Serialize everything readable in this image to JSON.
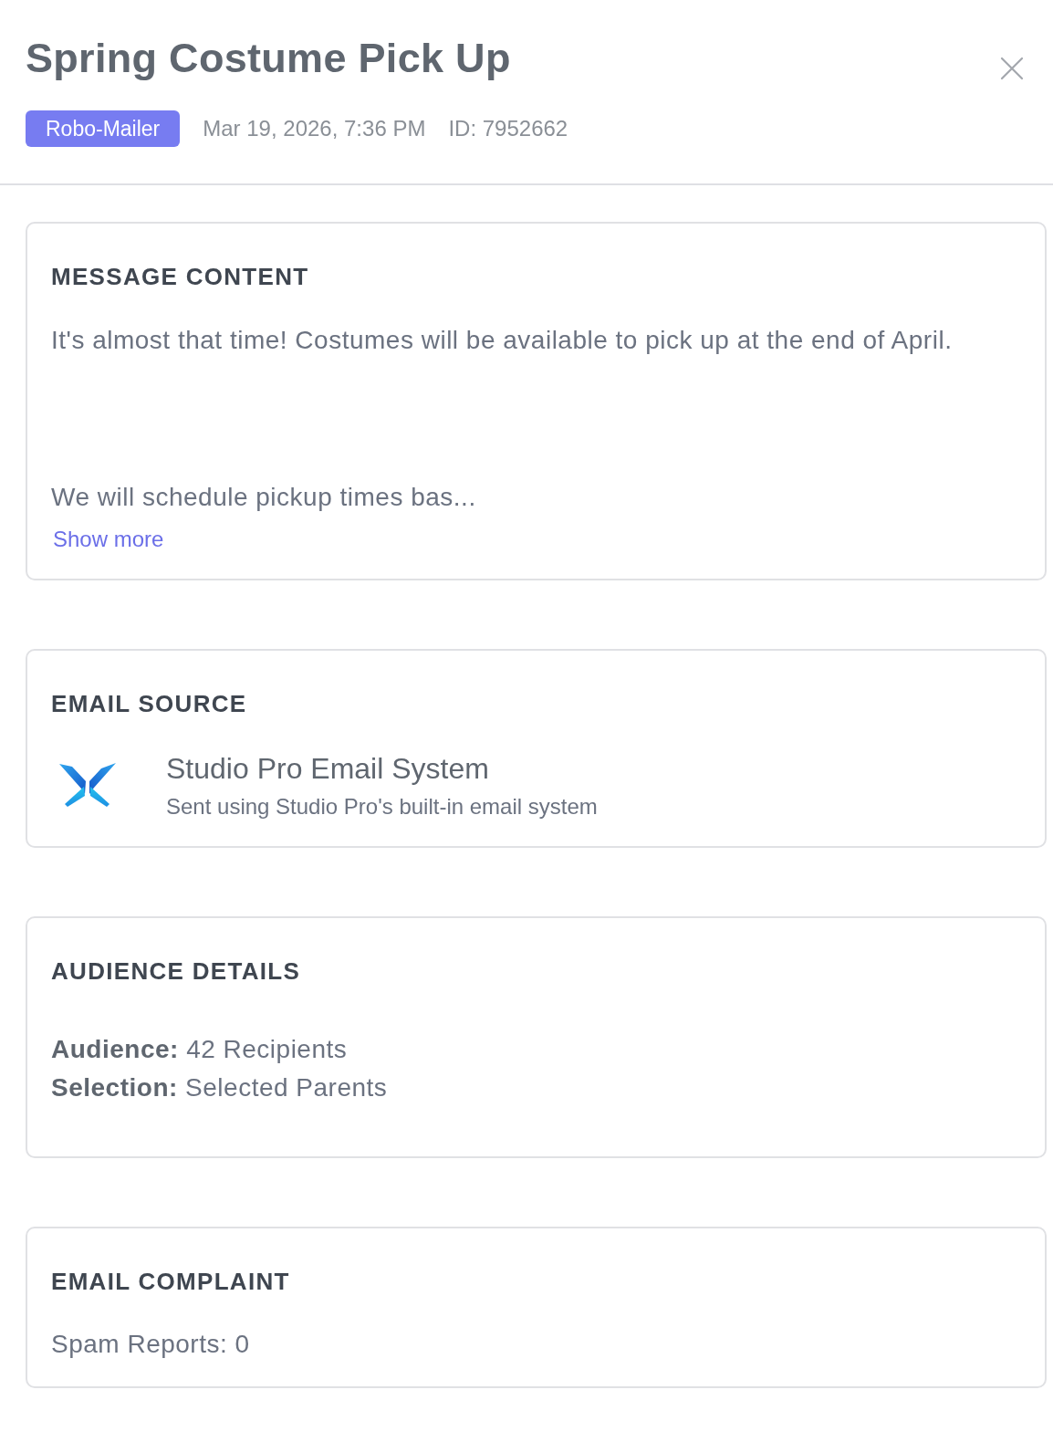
{
  "header": {
    "title": "Spring Costume Pick Up",
    "badge": "Robo-Mailer",
    "timestamp": "Mar 19, 2026, 7:36 PM",
    "id": "ID: 7952662"
  },
  "sections": [
    {
      "kind": "message",
      "heading": "MESSAGE CONTENT",
      "paragraphs": [
        "It's almost that time! Costumes will be available to pick up at the end of April.",
        "We will schedule pickup times bas..."
      ],
      "link": "Show more"
    },
    {
      "kind": "source",
      "heading": "EMAIL SOURCE",
      "name": "Studio Pro Email System",
      "description": "Sent using Studio Pro's built-in email system"
    },
    {
      "kind": "details",
      "heading": "AUDIENCE DETAILS",
      "rows": [
        "**Audience:** 42 Recipients",
        "**Selection:** Selected Parents"
      ]
    },
    {
      "kind": "stat",
      "heading": "EMAIL COMPLAINT",
      "text": "Spam Reports: 0"
    }
  ]
}
